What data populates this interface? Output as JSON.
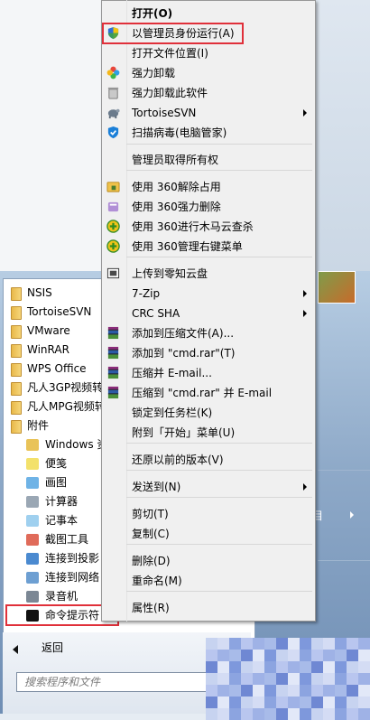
{
  "context_menu": {
    "items": [
      {
        "label": "打开(O)",
        "bold": true,
        "icon": "",
        "submenu": false
      },
      {
        "label": "以管理员身份运行(A)",
        "icon": "uac-shield-icon",
        "submenu": false
      },
      {
        "label": "打开文件位置(I)",
        "icon": "",
        "submenu": false
      },
      {
        "label": "强力卸载",
        "icon": "colorful-flower-icon",
        "submenu": false
      },
      {
        "label": "强力卸载此软件",
        "icon": "trash-icon",
        "submenu": false
      },
      {
        "label": "TortoiseSVN",
        "icon": "tortoise-icon",
        "submenu": true
      },
      {
        "label": "扫描病毒(电脑管家)",
        "icon": "shield-check-icon",
        "submenu": false
      },
      {
        "label": "管理员取得所有权",
        "icon": "",
        "submenu": false
      },
      {
        "label": "使用 360解除占用",
        "icon": "lock-folder-icon",
        "submenu": false
      },
      {
        "label": "使用 360强力删除",
        "icon": "delete-360-icon",
        "submenu": false
      },
      {
        "label": "使用 360进行木马云查杀",
        "icon": "360-plus-icon",
        "submenu": false
      },
      {
        "label": "使用 360管理右键菜单",
        "icon": "360-plus-icon",
        "submenu": false
      },
      {
        "label": "上传到零知云盘",
        "icon": "cloud-upload-icon",
        "submenu": false
      },
      {
        "label": "7-Zip",
        "icon": "",
        "submenu": true
      },
      {
        "label": "CRC SHA",
        "icon": "",
        "submenu": true
      },
      {
        "label": "添加到压缩文件(A)...",
        "icon": "winrar-icon",
        "submenu": false
      },
      {
        "label": "添加到 \"cmd.rar\"(T)",
        "icon": "winrar-icon",
        "submenu": false
      },
      {
        "label": "压缩并 E-mail...",
        "icon": "winrar-icon",
        "submenu": false
      },
      {
        "label": "压缩到 \"cmd.rar\" 并 E-mail",
        "icon": "winrar-icon",
        "submenu": false
      },
      {
        "label": "锁定到任务栏(K)",
        "icon": "",
        "submenu": false
      },
      {
        "label": "附到「开始」菜单(U)",
        "icon": "",
        "submenu": false
      },
      {
        "label": "还原以前的版本(V)",
        "icon": "",
        "submenu": false
      },
      {
        "label": "发送到(N)",
        "icon": "",
        "submenu": true
      },
      {
        "label": "剪切(T)",
        "icon": "",
        "submenu": false
      },
      {
        "label": "复制(C)",
        "icon": "",
        "submenu": false
      },
      {
        "label": "删除(D)",
        "icon": "",
        "submenu": false
      },
      {
        "label": "重命名(M)",
        "icon": "",
        "submenu": false
      },
      {
        "label": "属性(R)",
        "icon": "",
        "submenu": false
      }
    ]
  },
  "start_menu": {
    "programs": [
      {
        "label": "NSIS",
        "type": "folder"
      },
      {
        "label": "TortoiseSVN",
        "type": "folder"
      },
      {
        "label": "VMware",
        "type": "folder"
      },
      {
        "label": "WinRAR",
        "type": "folder"
      },
      {
        "label": "WPS Office",
        "type": "folder"
      },
      {
        "label": "凡人3GP视频转",
        "type": "folder"
      },
      {
        "label": "凡人MPG视频转",
        "type": "folder"
      },
      {
        "label": "附件",
        "type": "folder"
      },
      {
        "label": "Windows 资",
        "type": "app",
        "icon": "explorer-icon"
      },
      {
        "label": "便笺",
        "type": "app",
        "icon": "sticky-note-icon"
      },
      {
        "label": "画图",
        "type": "app",
        "icon": "paint-icon"
      },
      {
        "label": "计算器",
        "type": "app",
        "icon": "calculator-icon"
      },
      {
        "label": "记事本",
        "type": "app",
        "icon": "notepad-icon"
      },
      {
        "label": "截图工具",
        "type": "app",
        "icon": "snipping-icon"
      },
      {
        "label": "连接到投影",
        "type": "app",
        "icon": "projector-icon"
      },
      {
        "label": "连接到网络",
        "type": "app",
        "icon": "network-icon"
      },
      {
        "label": "录音机",
        "type": "app",
        "icon": "microphone-icon"
      },
      {
        "label": "命令提示符",
        "type": "app",
        "icon": "cmd-icon"
      }
    ],
    "back_label": "返回",
    "search_placeholder": "搜索程序和文件",
    "right_pane_char": "目"
  },
  "colors": {
    "highlight_box": "#e0303a",
    "menu_bg": "#f0f0f0",
    "start_menu_blue": "#8ea9c8"
  }
}
